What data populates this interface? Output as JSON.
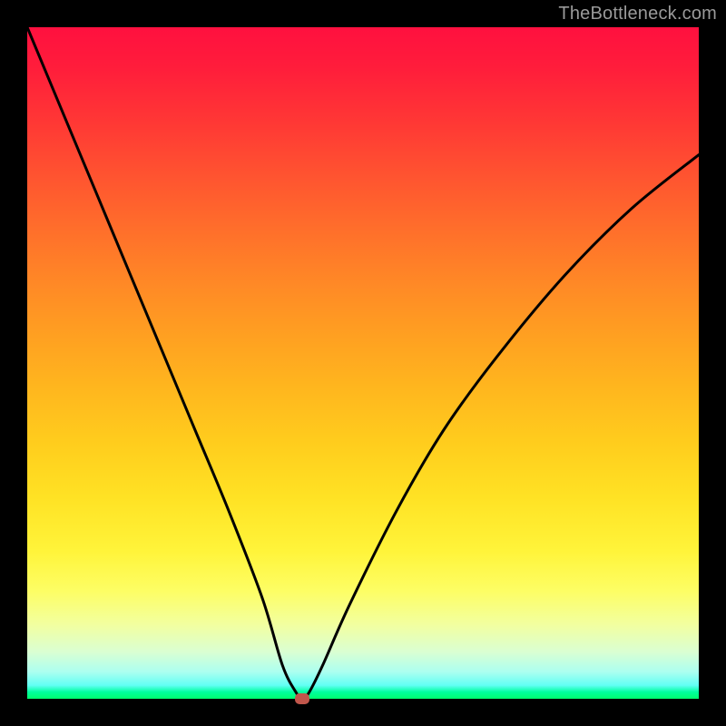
{
  "watermark": "TheBottleneck.com",
  "colors": {
    "frame": "#000000",
    "curve": "#000000",
    "marker": "#c1564b",
    "watermark": "#9a9a9a"
  },
  "chart_data": {
    "type": "line",
    "title": "",
    "xlabel": "",
    "ylabel": "",
    "x_range": [
      0,
      100
    ],
    "y_range": [
      0,
      100
    ],
    "series": [
      {
        "name": "bottleneck-curve",
        "x": [
          0,
          5,
          10,
          15,
          20,
          25,
          30,
          35,
          38,
          40,
          41,
          42,
          44,
          48,
          55,
          62,
          70,
          80,
          90,
          100
        ],
        "y": [
          100,
          88,
          76,
          64,
          52,
          40,
          28,
          15,
          5,
          1,
          0,
          1,
          5,
          14,
          28,
          40,
          51,
          63,
          73,
          81
        ]
      }
    ],
    "marker": {
      "x": 41,
      "y": 0
    },
    "grid": false,
    "legend": false
  }
}
